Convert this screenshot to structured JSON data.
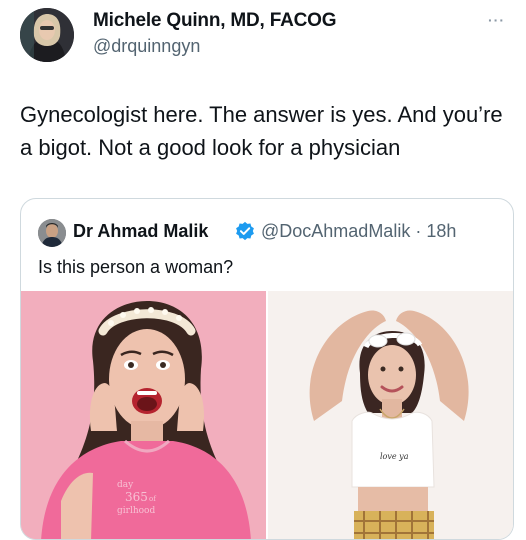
{
  "author": {
    "name": "Michele Quinn, MD, FACOG",
    "handle": "@drquinngyn"
  },
  "more_icon": "···",
  "tweet": {
    "text": "Gynecologist here. The answer is yes. And you’re a bigot. Not a good look for a physician"
  },
  "quoted": {
    "name": "Dr Ahmad Malik",
    "handle_time": "@DocAhmadMalik · 18h",
    "text": "Is this person a woman?",
    "verified_icon": "verified-badge-icon",
    "shirt_left_text": "day 365 of girlhood",
    "shirt_right_text": "love ya"
  },
  "colors": {
    "text": "#0f1419",
    "secondary": "#536471",
    "border": "#cfd9de",
    "verified": "#1d9bf0",
    "left_bg": "#f2aebd",
    "right_bg": "#f6f1ee"
  }
}
